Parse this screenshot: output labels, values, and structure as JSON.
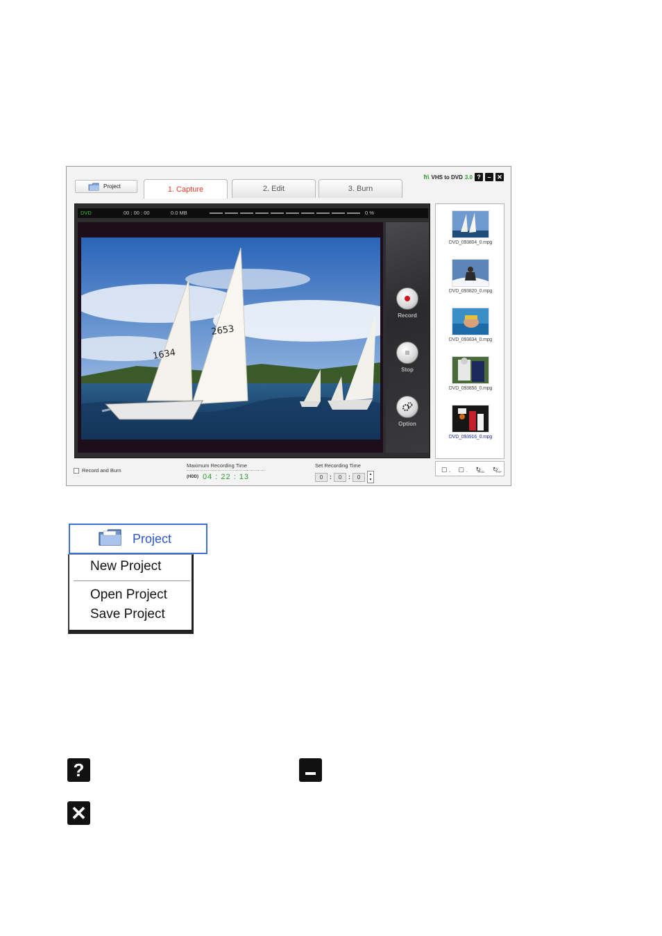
{
  "window": {
    "brand": "VHS to DVD",
    "version": "3.0",
    "project_button": "Project",
    "tabs": [
      "1. Capture",
      "2. Edit",
      "3. Burn"
    ],
    "window_controls": {
      "help": "?",
      "minimize": "–",
      "close": "✕"
    }
  },
  "capture": {
    "format": "DVD",
    "elapsed_time": "00 : 00 : 00",
    "size": "0.0 MB",
    "progress_percent": "0 %",
    "progress_value": 0,
    "controls": {
      "record": "Record",
      "stop": "Stop",
      "option": "Option"
    }
  },
  "bottom": {
    "record_and_burn_label": "Record and Burn",
    "record_and_burn_checked": false,
    "max_recording_time_label": "Maximum Recording Time",
    "drive": "(HDD)",
    "max_recording_time_value": "04 : 22 : 13",
    "set_recording_time_label": "Set Recording Time",
    "set_hours": "0",
    "set_minutes": "0",
    "set_seconds": "0"
  },
  "files": [
    {
      "name": "DVD_093804_0.mpg",
      "thumb": "sailing"
    },
    {
      "name": "DVD_093820_0.mpg",
      "thumb": "skiing"
    },
    {
      "name": "DVD_093834_0.mpg",
      "thumb": "swimming"
    },
    {
      "name": "DVD_093856_0.mpg",
      "thumb": "football"
    },
    {
      "name": "DVD_093916_0.mpg",
      "thumb": "basketball",
      "selected": true
    }
  ],
  "file_tools": [
    "add-file-icon",
    "remove-file-icon",
    "convert-ipod-icon",
    "convert-psp-icon"
  ],
  "file_tool_labels": {
    "ipod": "IPOD",
    "psp": "PSP"
  },
  "project_menu": {
    "button": "Project",
    "items": [
      "New Project",
      "Open Project",
      "Save Project"
    ]
  },
  "legend_icons": [
    "help-icon",
    "minimize-icon",
    "close-icon"
  ],
  "colors": {
    "accent_green": "#2e9a2e",
    "active_tab": "#e23b2a",
    "record_red": "#d4151b",
    "menu_blue": "#2a56c8"
  }
}
